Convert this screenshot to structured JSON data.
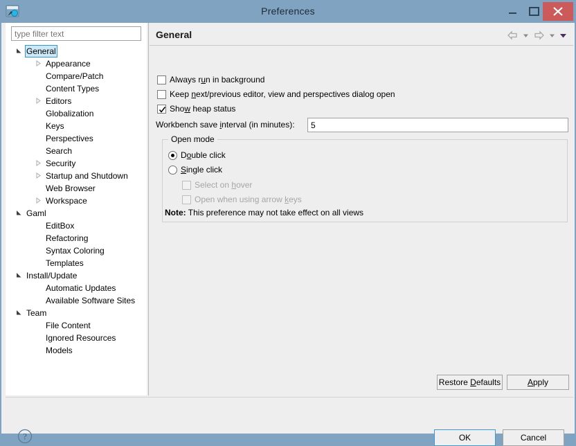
{
  "window": {
    "title": "Preferences",
    "app_icon": "gama-window-icon",
    "controls": {
      "minimize": "minimize-icon",
      "maximize": "maximize-icon",
      "close": "close-icon",
      "close_color": "#cc5a5a"
    }
  },
  "sidebar": {
    "filter": {
      "value": "",
      "placeholder": "type filter text"
    },
    "selected": "General",
    "tree": [
      {
        "label": "General",
        "level": 0,
        "state": "expanded",
        "selected": true
      },
      {
        "label": "Appearance",
        "level": 1,
        "state": "collapsed",
        "selected": false
      },
      {
        "label": "Compare/Patch",
        "level": 1,
        "state": "leaf",
        "selected": false
      },
      {
        "label": "Content Types",
        "level": 1,
        "state": "leaf",
        "selected": false
      },
      {
        "label": "Editors",
        "level": 1,
        "state": "collapsed",
        "selected": false
      },
      {
        "label": "Globalization",
        "level": 1,
        "state": "leaf",
        "selected": false
      },
      {
        "label": "Keys",
        "level": 1,
        "state": "leaf",
        "selected": false
      },
      {
        "label": "Perspectives",
        "level": 1,
        "state": "leaf",
        "selected": false
      },
      {
        "label": "Search",
        "level": 1,
        "state": "leaf",
        "selected": false
      },
      {
        "label": "Security",
        "level": 1,
        "state": "collapsed",
        "selected": false
      },
      {
        "label": "Startup and Shutdown",
        "level": 1,
        "state": "collapsed",
        "selected": false
      },
      {
        "label": "Web Browser",
        "level": 1,
        "state": "leaf",
        "selected": false
      },
      {
        "label": "Workspace",
        "level": 1,
        "state": "collapsed",
        "selected": false
      },
      {
        "label": "Gaml",
        "level": 0,
        "state": "expanded",
        "selected": false
      },
      {
        "label": "EditBox",
        "level": 1,
        "state": "leaf",
        "selected": false
      },
      {
        "label": "Refactoring",
        "level": 1,
        "state": "leaf",
        "selected": false
      },
      {
        "label": "Syntax Coloring",
        "level": 1,
        "state": "leaf",
        "selected": false
      },
      {
        "label": "Templates",
        "level": 1,
        "state": "leaf",
        "selected": false
      },
      {
        "label": "Install/Update",
        "level": 0,
        "state": "expanded",
        "selected": false
      },
      {
        "label": "Automatic Updates",
        "level": 1,
        "state": "leaf",
        "selected": false
      },
      {
        "label": "Available Software Sites",
        "level": 1,
        "state": "leaf",
        "selected": false
      },
      {
        "label": "Team",
        "level": 0,
        "state": "expanded",
        "selected": false
      },
      {
        "label": "File Content",
        "level": 1,
        "state": "leaf",
        "selected": false
      },
      {
        "label": "Ignored Resources",
        "level": 1,
        "state": "leaf",
        "selected": false
      },
      {
        "label": "Models",
        "level": 1,
        "state": "leaf",
        "selected": false
      }
    ]
  },
  "content": {
    "page_title": "General",
    "nav": {
      "back_icon": "back-arrow-icon",
      "back_menu_icon": "chevron-down-icon",
      "forward_icon": "forward-arrow-icon",
      "forward_menu_icon": "chevron-down-icon",
      "view_menu_icon": "chevron-down-filled-icon"
    },
    "checkboxes": [
      {
        "label_pre": "Always r",
        "mnemonic": "u",
        "label_post": "n in background",
        "checked": false,
        "enabled": true
      },
      {
        "label_pre": "Keep ",
        "mnemonic": "n",
        "label_post": "ext/previous editor, view and perspectives dialog open",
        "checked": false,
        "enabled": true
      },
      {
        "label_pre": "Sho",
        "mnemonic": "w",
        "label_post": " heap status",
        "checked": true,
        "enabled": true
      }
    ],
    "save_interval": {
      "label_pre": "Workbench save ",
      "mnemonic": "i",
      "label_post": "nterval (in minutes):",
      "value": "5"
    },
    "open_mode": {
      "legend": "Open mode",
      "radios": [
        {
          "label_pre": "D",
          "mnemonic": "o",
          "label_post": "uble click",
          "selected": true
        },
        {
          "label_pre": "",
          "mnemonic": "S",
          "label_post": "ingle click",
          "selected": false
        }
      ],
      "sub_checkboxes": [
        {
          "label_pre": "Select on ",
          "mnemonic": "h",
          "label_post": "over",
          "checked": false,
          "enabled": false
        },
        {
          "label_pre": "Open when using arrow ",
          "mnemonic": "k",
          "label_post": "eys",
          "checked": false,
          "enabled": false
        }
      ],
      "note_label": "Note:",
      "note_text": "This preference may not take effect on all views"
    },
    "buttons": {
      "restore_pre": "Restore ",
      "restore_mnemonic": "D",
      "restore_post": "efaults",
      "apply_pre": "",
      "apply_mnemonic": "A",
      "apply_post": "pply"
    }
  },
  "footer": {
    "help_icon": "help-question-icon",
    "ok": "OK",
    "cancel": "Cancel",
    "ok_focus_color": "#3c9ad6"
  }
}
